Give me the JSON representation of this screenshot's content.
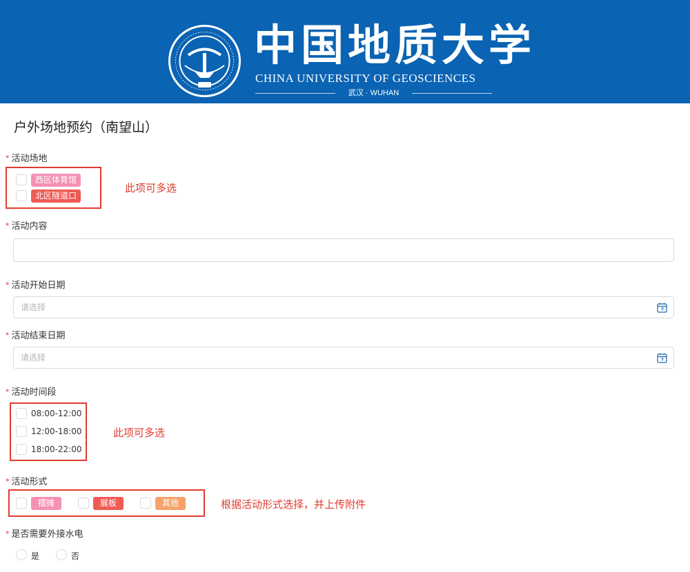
{
  "header": {
    "cn_title": "中国地质大学",
    "en_title": "CHINA UNIVERSITY OF GEOSCIENCES",
    "location": "武汉 · WUHAN",
    "seal_icon": "university-seal-icon",
    "brand_color": "#0a63b3"
  },
  "form": {
    "title": "户外场地预约（南望山）",
    "required_mark": "*",
    "venue": {
      "label": "活动场地",
      "options": [
        {
          "label": "西区体育馆",
          "color": "#f590b5"
        },
        {
          "label": "北区隧道口",
          "color": "#ef5a55"
        }
      ],
      "note": "此项可多选"
    },
    "content": {
      "label": "活动内容",
      "value": ""
    },
    "start_date": {
      "label": "活动开始日期",
      "placeholder": "请选择",
      "icon": "calendar-icon"
    },
    "end_date": {
      "label": "活动结束日期",
      "placeholder": "请选择",
      "icon": "calendar-icon"
    },
    "time_slot": {
      "label": "活动时间段",
      "options": [
        "08:00-12:00",
        "12:00-18:00",
        "18:00-22:00"
      ],
      "note": "此项可多选"
    },
    "format": {
      "label": "活动形式",
      "options": [
        {
          "label": "摆摊",
          "color": "#f590b5"
        },
        {
          "label": "展板",
          "color": "#ef5a55"
        },
        {
          "label": "其他",
          "color": "#f5a36b"
        }
      ],
      "note": "根据活动形式选择，并上传附件"
    },
    "utilities": {
      "label": "是否需要外接水电",
      "options": [
        "是",
        "否"
      ]
    }
  }
}
